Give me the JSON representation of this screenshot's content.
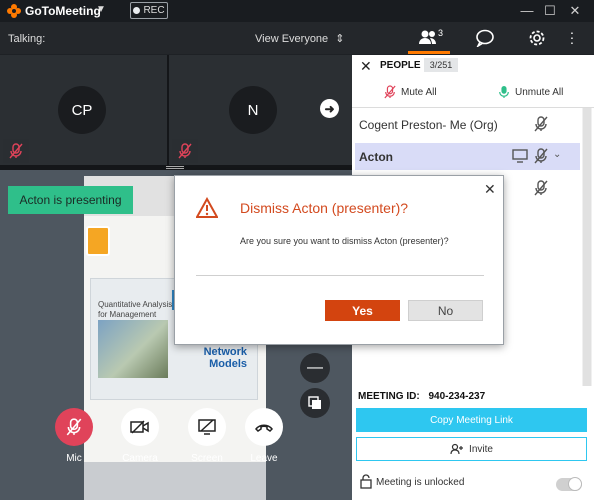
{
  "titlebar": {
    "app_name": "GoToMeeting",
    "rec_label": "REC",
    "logo_icon": "gotomeeting-flower-icon",
    "window_controls": [
      "minimize",
      "maximize",
      "close"
    ]
  },
  "subbar": {
    "talking_label": "Talking:",
    "view_label": "View Everyone",
    "people_count": "3"
  },
  "tiles": [
    {
      "initials": "CP"
    },
    {
      "initials": "N"
    }
  ],
  "presenting_label": "Acton is presenting",
  "controls": {
    "mic": "Mic",
    "camera": "Camera",
    "screen": "Screen",
    "leave": "Leave"
  },
  "dialog": {
    "title": "Dismiss Acton (presenter)?",
    "message": "Are you sure you want to dismiss Acton (presenter)?",
    "yes_label": "Yes",
    "no_label": "No"
  },
  "shared_doc": {
    "book_title": "Quantitative Analysis for Management",
    "assign_text": "Assignment, and Network Models"
  },
  "people_panel": {
    "title": "PEOPLE",
    "count": "3/251",
    "mute_all": "Mute All",
    "unmute_all": "Unmute All",
    "people": [
      {
        "name": "Cogent Preston",
        "role": " - Me (Org)"
      },
      {
        "name": "Acton",
        "role": ""
      },
      {
        "name": "",
        "role": ""
      }
    ],
    "meeting_id_label": "MEETING ID:",
    "meeting_id": "940-234-237",
    "copy_link_label": "Copy Meeting Link",
    "invite_label": "Invite",
    "lock_text": "Meeting is unlocked"
  },
  "colors": {
    "accent": "#ff7a00",
    "presenting_bg": "#2fbf8a",
    "yes_button": "#d3440f",
    "copy_button": "#2ec7f0",
    "mic_red": "#e0435a"
  }
}
